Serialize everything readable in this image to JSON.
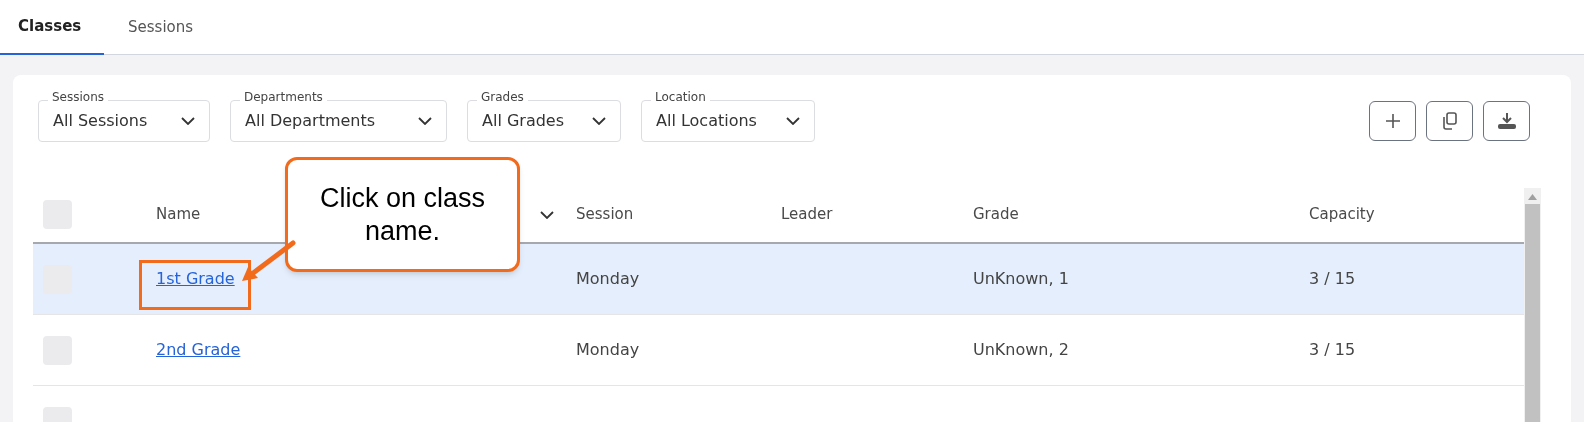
{
  "tabs": [
    {
      "label": "Classes",
      "selected": true
    },
    {
      "label": "Sessions",
      "selected": false
    }
  ],
  "filters": [
    {
      "label": "Sessions",
      "value": "All Sessions"
    },
    {
      "label": "Departments",
      "value": "All Departments"
    },
    {
      "label": "Grades",
      "value": "All Grades"
    },
    {
      "label": "Location",
      "value": "All Locations"
    }
  ],
  "actions": [
    {
      "kind": "add"
    },
    {
      "kind": "copy"
    },
    {
      "kind": "download"
    }
  ],
  "table": {
    "header_checked": false,
    "columns": [
      "Name",
      "Session",
      "Leader",
      "Grade",
      "Capacity"
    ],
    "rows": [
      {
        "selected": true,
        "checked": false,
        "name": "1st Grade",
        "session": "Monday",
        "leader": "",
        "grade": "UnKnown, 1",
        "capacity": "3 / 15"
      },
      {
        "selected": false,
        "checked": false,
        "name": "2nd Grade",
        "session": "Monday",
        "leader": "",
        "grade": "UnKnown, 2",
        "capacity": "3 / 15"
      },
      {
        "selected": false,
        "checked": false
      }
    ]
  },
  "callout": {
    "text": "Click on class name."
  }
}
